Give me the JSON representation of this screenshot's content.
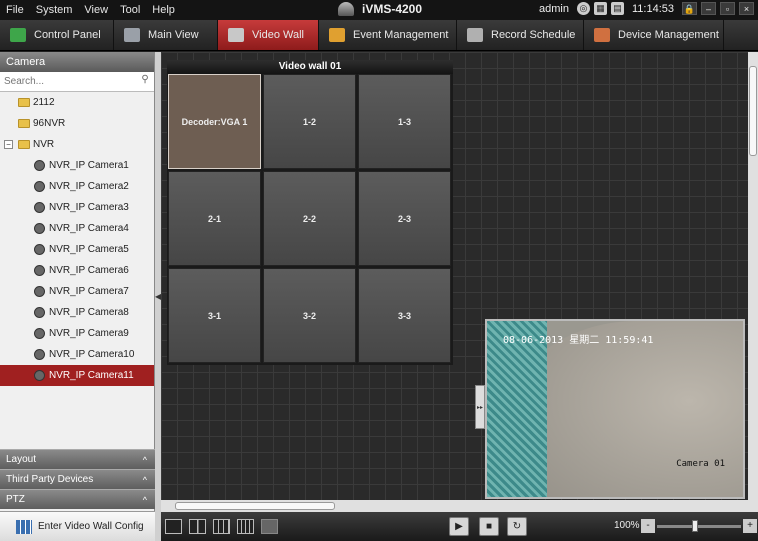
{
  "menu": [
    "File",
    "System",
    "View",
    "Tool",
    "Help"
  ],
  "app_title": "iVMS-4200",
  "user": "admin",
  "clock": "11:14:53",
  "window_buttons": {
    "lock": "🔒",
    "minimize": "–",
    "maximize": "▫",
    "close": "×"
  },
  "tabs": [
    {
      "label": "Control Panel",
      "color": "#3ea64a"
    },
    {
      "label": "Main View",
      "color": "#9aa0a8"
    },
    {
      "label": "Video Wall",
      "color": "#c8c8c8"
    },
    {
      "label": "Event Management",
      "color": "#e0a030"
    },
    {
      "label": "Record Schedule",
      "color": "#b0b0b0"
    },
    {
      "label": "Device Management",
      "color": "#d07040"
    }
  ],
  "active_tab": "Video Wall",
  "sidebar": {
    "header": "Camera",
    "search_placeholder": "Search...",
    "tree": [
      {
        "label": "2112",
        "type": "folder"
      },
      {
        "label": "96NVR",
        "type": "folder"
      },
      {
        "label": "NVR",
        "type": "folder",
        "expanded": true,
        "expand_symbol": "−"
      },
      {
        "label": "NVR_IP Camera1",
        "type": "camera"
      },
      {
        "label": "NVR_IP Camera2",
        "type": "camera"
      },
      {
        "label": "NVR_IP Camera3",
        "type": "camera"
      },
      {
        "label": "NVR_IP Camera4",
        "type": "camera"
      },
      {
        "label": "NVR_IP Camera5",
        "type": "camera"
      },
      {
        "label": "NVR_IP Camera6",
        "type": "camera"
      },
      {
        "label": "NVR_IP Camera7",
        "type": "camera"
      },
      {
        "label": "NVR_IP Camera8",
        "type": "camera"
      },
      {
        "label": "NVR_IP Camera9",
        "type": "camera"
      },
      {
        "label": "NVR_IP Camera10",
        "type": "camera"
      },
      {
        "label": "NVR_IP Camera11",
        "type": "camera",
        "selected": true
      }
    ],
    "panels": [
      {
        "label": "Layout",
        "chevron": "^"
      },
      {
        "label": "Third Party Devices",
        "chevron": "^"
      },
      {
        "label": "PTZ",
        "chevron": "^"
      }
    ],
    "enter_button": "Enter Video Wall Config"
  },
  "video_wall": {
    "title": "Video wall 01",
    "cells": [
      "Decoder:VGA 1",
      "1-2",
      "1-3",
      "2-1",
      "2-2",
      "2-3",
      "3-1",
      "3-2",
      "3-3"
    ]
  },
  "video_preview": {
    "timestamp": "08-06-2013 星期二 11:59:41",
    "camera_label": "Camera 01"
  },
  "bottom_bar": {
    "zoom": "100%",
    "zoom_minus": "-",
    "zoom_plus": "+",
    "zoom_level": 0.45,
    "play": "▶",
    "stop": "■",
    "refresh": "↻"
  }
}
